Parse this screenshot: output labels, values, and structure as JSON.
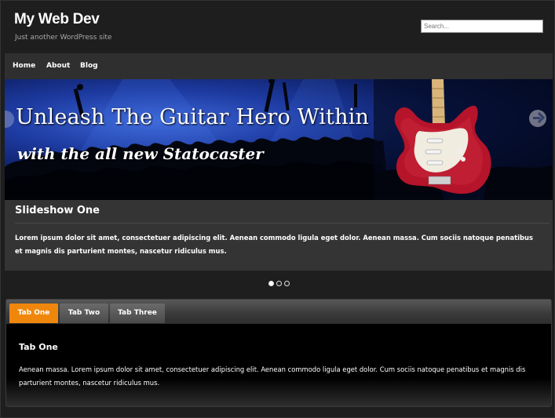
{
  "header": {
    "site_title": "My Web Dev",
    "tagline": "Just another WordPress site",
    "search_placeholder": "Search..."
  },
  "nav": {
    "items": [
      {
        "label": "Home"
      },
      {
        "label": "About"
      },
      {
        "label": "Blog"
      }
    ]
  },
  "slideshow": {
    "headline": "Unleash The Guitar Hero Within",
    "subline": "with the all new Statocaster",
    "title": "Slideshow One",
    "text": "Lorem ipsum dolor sit amet, consectetuer adipiscing elit. Aenean commodo ligula eget dolor. Aenean massa. Cum sociis natoque penatibus et magnis dis parturient montes, nascetur ridiculus mus.",
    "dot_count": 3,
    "active_dot": 1
  },
  "tabs": {
    "items": [
      {
        "label": "Tab One",
        "active": true
      },
      {
        "label": "Tab Two",
        "active": false
      },
      {
        "label": "Tab Three",
        "active": false
      }
    ],
    "content_title": "Tab One",
    "content_text": "Aenean massa. Lorem ipsum dolor sit amet, consectetuer adipiscing elit. Aenean commodo ligula eget dolor. Cum sociis natoque penatibus et magnis dis parturient montes, nascetur ridiculus mus."
  },
  "colors": {
    "background": "#1e1e1e",
    "nav_bg": "#2f2f2f",
    "active_tab": "#f0870d",
    "slider_bg": "#343434"
  }
}
